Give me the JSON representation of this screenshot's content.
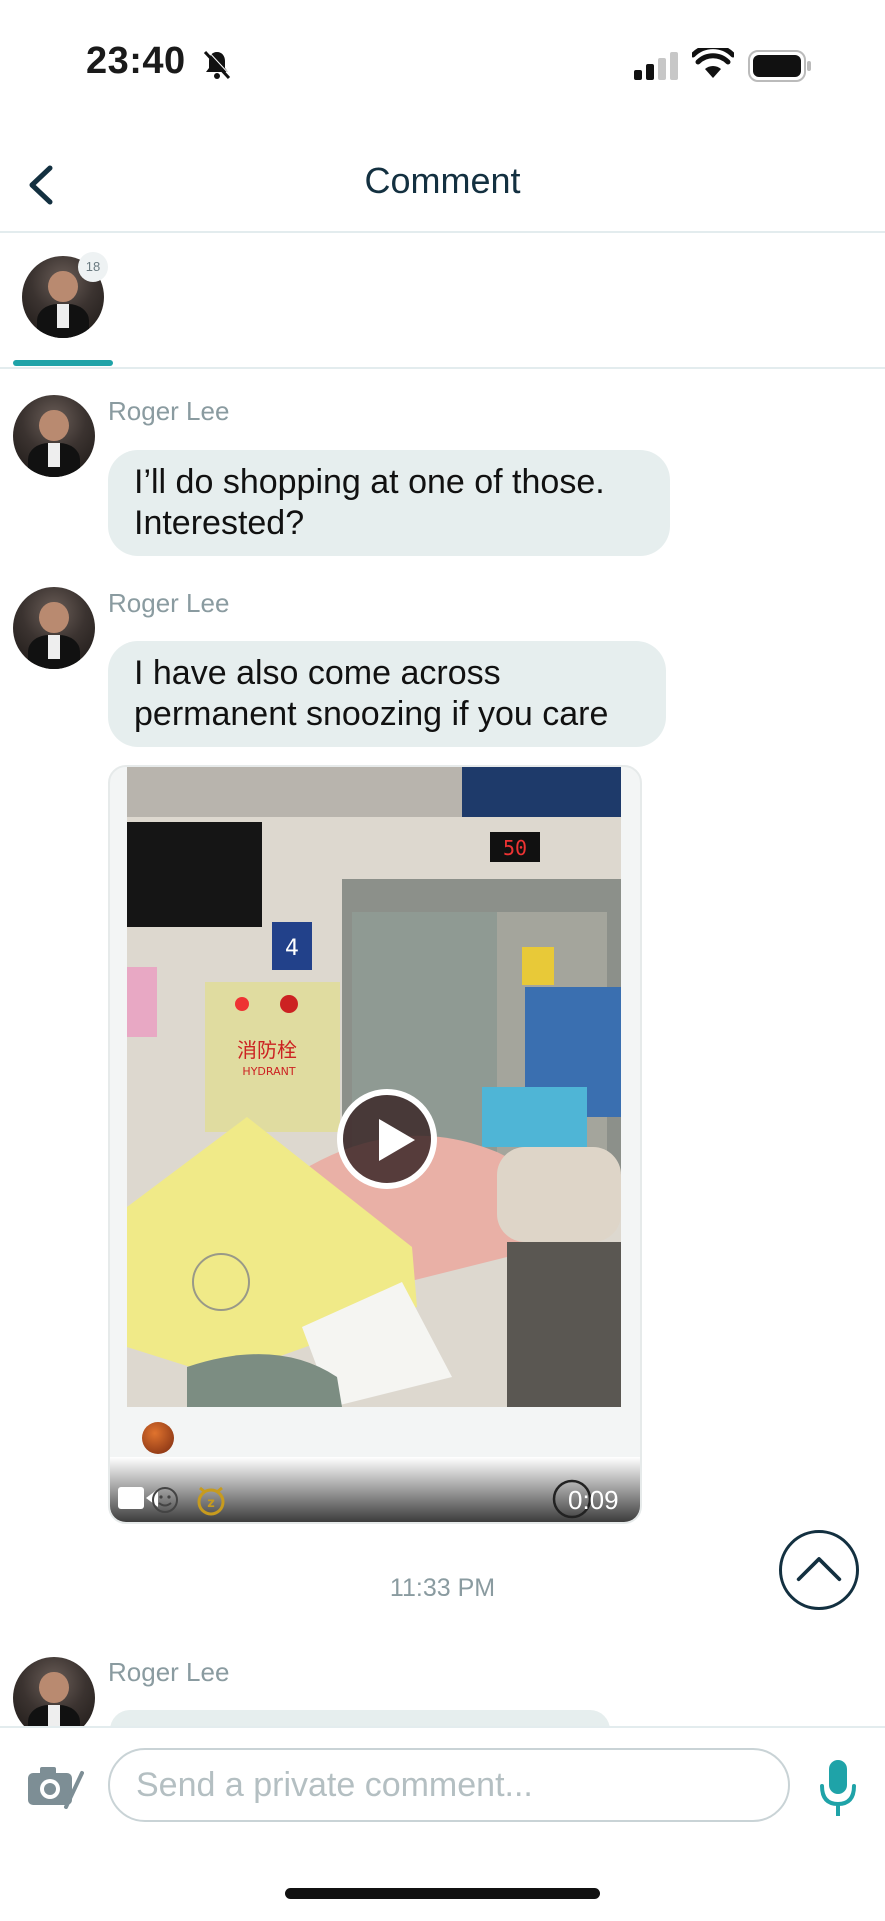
{
  "status_bar": {
    "time": "23:40"
  },
  "header": {
    "title": "Comment"
  },
  "tabs": [
    {
      "badge": "18"
    }
  ],
  "messages": [
    {
      "sender": "Roger Lee",
      "text": "I’ll do shopping at one of those. Interested?"
    },
    {
      "sender": "Roger Lee",
      "text": "I have also come across permanent snoozing if you care"
    },
    {
      "sender": "Roger Lee"
    }
  ],
  "video": {
    "duration": "0:09",
    "sign_text": "消防栓",
    "sign_subtext": "HYDRANT",
    "display_number": "50",
    "room_number": "4"
  },
  "timestamp": "11:33 PM",
  "composer": {
    "placeholder": "Send a private comment..."
  },
  "colors": {
    "accent": "#1fa3a8",
    "navy": "#133040",
    "bubble": "#e6eeee",
    "muted": "#8a9ba0"
  }
}
